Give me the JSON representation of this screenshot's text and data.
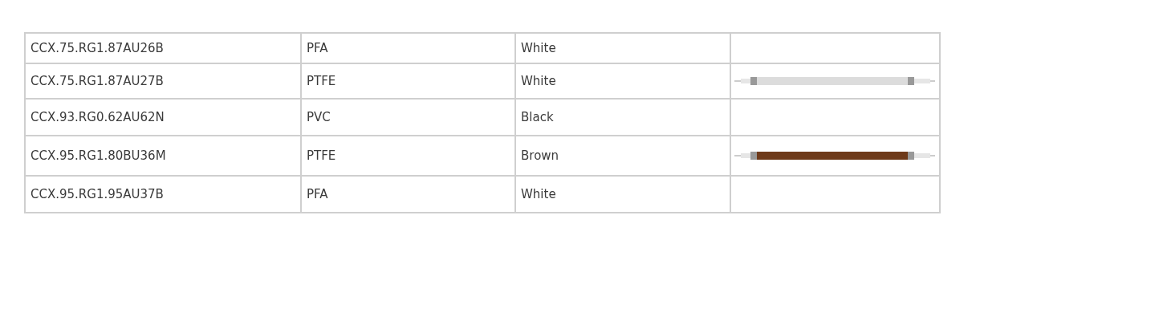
{
  "table": {
    "rows": [
      {
        "code": "CCX.75.RG1.87AU26B",
        "material": "PFA",
        "color_name": "White"
      },
      {
        "code": "CCX.75.RG1.87AU27B",
        "material": "PTFE",
        "color_name": "White",
        "wire": {
          "kind": "cable",
          "color": "#dcdcdc"
        }
      },
      {
        "code": "CCX.93.RG0.62AU62N",
        "material": "PVC",
        "color_name": "Black"
      },
      {
        "code": "CCX.95.RG1.80BU36M",
        "material": "PTFE",
        "color_name": "Brown",
        "wire": {
          "kind": "cable",
          "color": "#6e3a1a"
        }
      },
      {
        "code": "CCX.95.RG1.95AU37B",
        "material": "PFA",
        "color_name": "White"
      }
    ]
  }
}
